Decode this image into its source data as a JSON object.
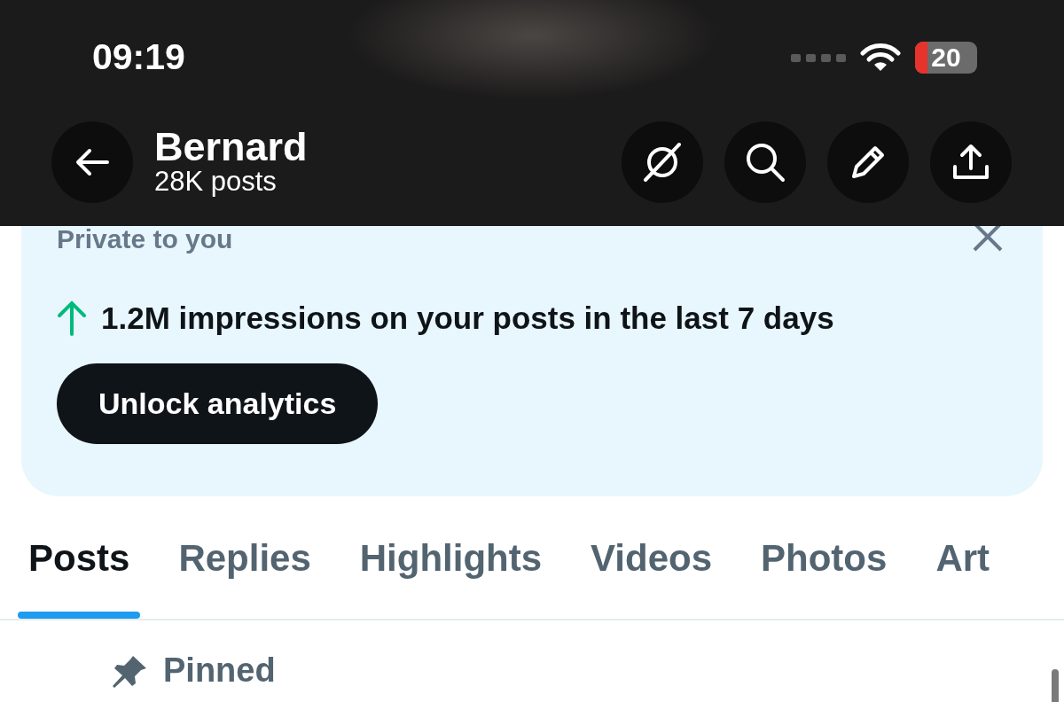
{
  "status_bar": {
    "time": "09:19",
    "battery": "20"
  },
  "header": {
    "title": "Bernard",
    "subtitle": "28K posts"
  },
  "notice": {
    "label": "Private to you",
    "message": "1.2M impressions on your posts in the last 7 days",
    "button": "Unlock analytics"
  },
  "tabs": [
    {
      "label": "Posts",
      "selected": true
    },
    {
      "label": "Replies",
      "selected": false
    },
    {
      "label": "Highlights",
      "selected": false
    },
    {
      "label": "Videos",
      "selected": false
    },
    {
      "label": "Photos",
      "selected": false
    },
    {
      "label": "Art",
      "selected": false
    }
  ],
  "pinned": {
    "label": "Pinned"
  }
}
